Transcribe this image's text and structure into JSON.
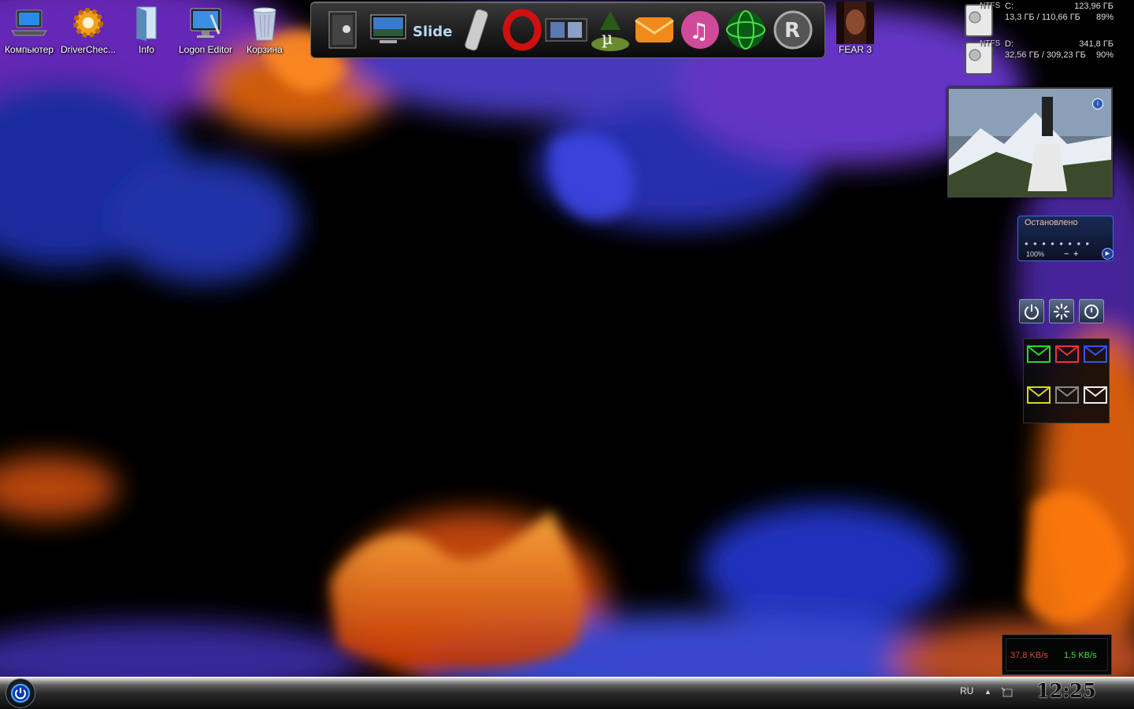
{
  "desktop_icons": [
    {
      "label": "Компьютер",
      "icon": "laptop-icon"
    },
    {
      "label": "DriverChec...",
      "icon": "gear-icon"
    },
    {
      "label": "Info",
      "icon": "open-door-icon"
    },
    {
      "label": "Logon Editor",
      "icon": "monitor-tools-icon"
    },
    {
      "label": "Корзина",
      "icon": "recycle-bin-icon"
    }
  ],
  "game_shortcut": {
    "label": "FEAR 3",
    "icon": "fear3-icon"
  },
  "dock": {
    "items": [
      {
        "name": "safe-icon"
      },
      {
        "name": "monitor-icon"
      },
      {
        "name": "slide-logo-icon"
      },
      {
        "name": "remote-control-icon"
      },
      {
        "name": "opera-icon"
      },
      {
        "name": "film-icon"
      },
      {
        "name": "utorrent-icon"
      },
      {
        "name": "mail-icon"
      },
      {
        "name": "music-icon"
      },
      {
        "name": "globe-icon"
      },
      {
        "name": "r-logo-icon"
      }
    ]
  },
  "drives": [
    {
      "fs": "NTFS",
      "letter": "C:",
      "total": "123,96 ГБ",
      "used": "13,3 ГБ / 110,66 ГБ",
      "pct": "89%"
    },
    {
      "fs": "NTFS",
      "letter": "D:",
      "total": "341,8 ГБ",
      "used": "32,56 ГБ / 309,23 ГБ",
      "pct": "90%"
    }
  ],
  "player": {
    "status": "Остановлено",
    "volume": "100%",
    "minus": "−",
    "plus": "+",
    "play": "▶"
  },
  "power_buttons": [
    "shutdown-icon",
    "restart-icon",
    "standby-icon"
  ],
  "mail_colors": [
    "#22dd22",
    "#ee3333",
    "#3355ee",
    "#d8d820",
    "#888888",
    "#f0f0f0"
  ],
  "net": {
    "down": "37,8 KB/s",
    "up": "1,5 KB/s"
  },
  "taskbar": {
    "lang": "RU",
    "tray_arrow": "▲",
    "clock": "12:25"
  }
}
